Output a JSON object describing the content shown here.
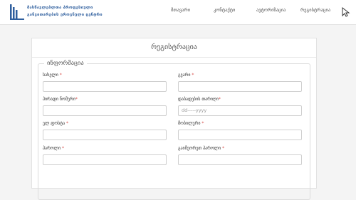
{
  "header": {
    "logo_line1": "მასწავლებლთა პროფესიული",
    "logo_line2": "განვითარების ეროვნული ცენტრი",
    "nav": [
      "მთავარი",
      "კონტაქტი",
      "ავტორიზაცია",
      "რეგისტრაცია"
    ]
  },
  "page": {
    "title": "რეგისტრაცია",
    "section_title": "ინფორმაცია"
  },
  "form": {
    "fields": [
      {
        "label": "სახელი",
        "required": "*",
        "value": ""
      },
      {
        "label": "გვარი",
        "required": "*",
        "value": ""
      },
      {
        "label": "პირადი ნომერი",
        "required": "*",
        "value": ""
      },
      {
        "label": "დაბადების თარიღი",
        "required": "*",
        "value": "dd-----yyyy"
      },
      {
        "label": "ელ.ფოსტა",
        "required": "*",
        "value": ""
      },
      {
        "label": "მობილური",
        "required": "*",
        "value": ""
      },
      {
        "label": "პაროლი",
        "required": "*",
        "value": ""
      },
      {
        "label": "გაიმეორეთ პაროლი",
        "required": "*",
        "value": ""
      }
    ]
  },
  "colors": {
    "brand": "#2f5f9e",
    "required": "#d9534f",
    "background": "#f4f4f4"
  },
  "icons": {
    "logo": "logo-bars-icon",
    "cursor": "mouse-cursor-icon"
  }
}
